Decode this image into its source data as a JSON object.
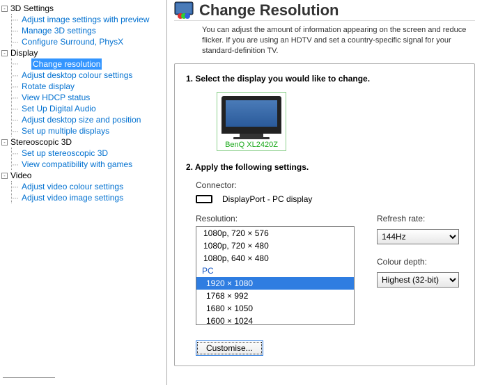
{
  "nav": {
    "categories": [
      {
        "label": "3D Settings",
        "items": [
          "Adjust image settings with preview",
          "Manage 3D settings",
          "Configure Surround, PhysX"
        ]
      },
      {
        "label": "Display",
        "selectedIndex": 0,
        "items": [
          "Change resolution",
          "Adjust desktop colour settings",
          "Rotate display",
          "View HDCP status",
          "Set Up Digital Audio",
          "Adjust desktop size and position",
          "Set up multiple displays"
        ]
      },
      {
        "label": "Stereoscopic 3D",
        "items": [
          "Set up stereoscopic 3D",
          "View compatibility with games"
        ]
      },
      {
        "label": "Video",
        "items": [
          "Adjust video colour settings",
          "Adjust video image settings"
        ]
      }
    ]
  },
  "header": {
    "title": "Change Resolution"
  },
  "intro": "You can adjust the amount of information appearing on the screen and reduce flicker. If you are using an HDTV and set a country-specific signal for your standard-definition TV.",
  "step1": {
    "title": "1. Select the display you would like to change.",
    "monitorLabel": "BenQ XL2420Z"
  },
  "step2": {
    "title": "2. Apply the following settings.",
    "connectorLabel": "Connector:",
    "connectorValue": "DisplayPort - PC display",
    "resolutionLabel": "Resolution:",
    "refreshLabel": "Refresh rate:",
    "refreshValue": "144Hz",
    "colourDepthLabel": "Colour depth:",
    "colourDepthValue": "Highest (32-bit)",
    "customiseLabel": "Customise..."
  },
  "resolutions": {
    "itemsTop": [
      "1080p, 720 × 576",
      "1080p, 720 × 480",
      "1080p, 640 × 480"
    ],
    "groupLabel": "PC",
    "selected": "1920 × 1080",
    "itemsBottom": [
      "1768 × 992",
      "1680 × 1050",
      "1600 × 1024"
    ]
  }
}
